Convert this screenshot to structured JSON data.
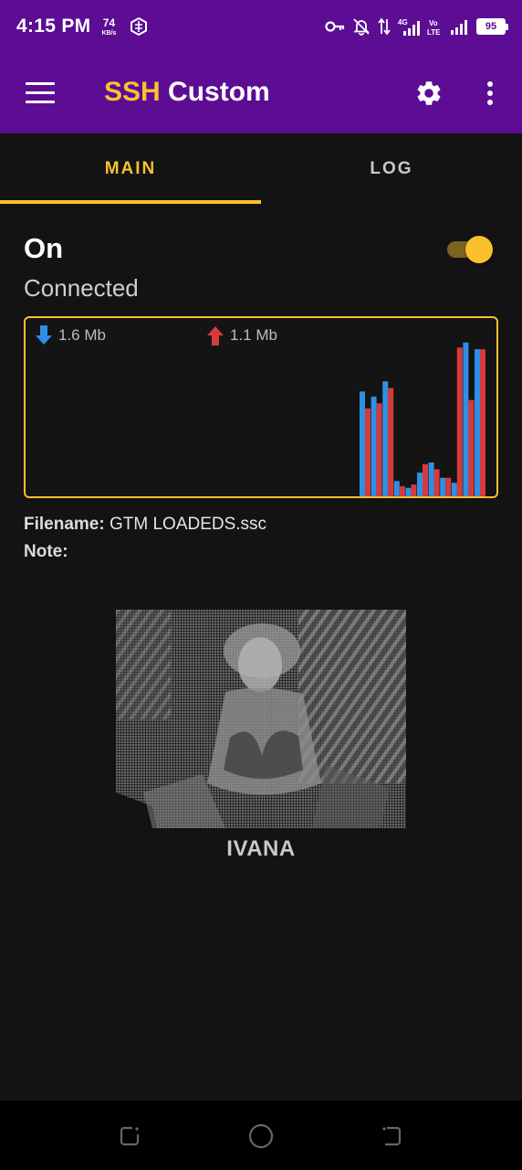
{
  "status_bar": {
    "time": "4:15 PM",
    "net_speed": "74",
    "net_speed_unit": "KB/s",
    "battery": "95"
  },
  "app_bar": {
    "title_part1": "SSH",
    "title_part2": "Custom",
    "icons": [
      "menu-icon",
      "gear-icon",
      "more-vert-icon"
    ]
  },
  "tabs": [
    {
      "label": "MAIN",
      "active": true
    },
    {
      "label": "LOG",
      "active": false
    }
  ],
  "connection": {
    "state": "On",
    "status": "Connected",
    "toggle_on": true
  },
  "traffic": {
    "download": "1.6 Mb",
    "upload": "1.1 Mb",
    "colors": {
      "download": "#2f8fe6",
      "upload": "#d73a3a"
    },
    "chart_data": {
      "type": "bar",
      "series": [
        {
          "values": [
            62,
            59,
            68,
            9,
            5,
            14,
            20,
            11,
            8,
            91,
            87
          ]
        },
        {
          "values": [
            52,
            55,
            64,
            6,
            7,
            19,
            16,
            11,
            88,
            57,
            87
          ]
        }
      ]
    }
  },
  "file": {
    "filename_label": "Filename:",
    "filename_value": "GTM LOADEDS.ssc",
    "note_label": "Note:",
    "note_value": ""
  },
  "banner": {
    "caption": "IVANA"
  },
  "colors": {
    "primary": "#5c0d94",
    "accent": "#fbc02d",
    "background": "#131313"
  }
}
